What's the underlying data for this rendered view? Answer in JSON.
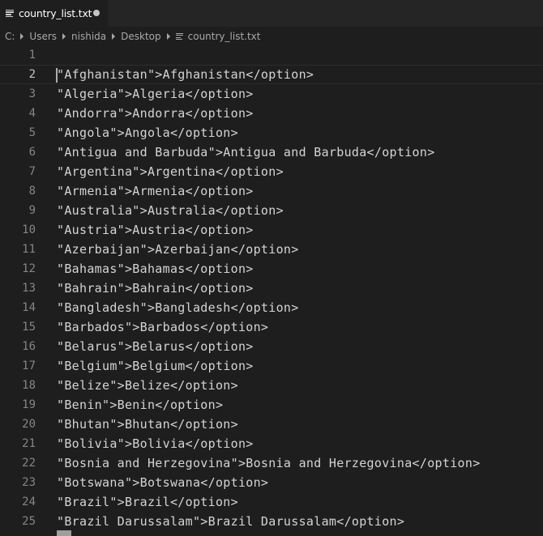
{
  "tab": {
    "filename": "country_list.txt",
    "icon": "lines-file-icon",
    "dirty": true
  },
  "breadcrumb": {
    "parts": [
      "C:",
      "Users",
      "nishida",
      "Desktop"
    ],
    "file": "country_list.txt"
  },
  "editor": {
    "current_line": 2,
    "lines": [
      {
        "num": "1",
        "text": ""
      },
      {
        "num": "2",
        "text": "\"Afghanistan\">Afghanistan</option>"
      },
      {
        "num": "3",
        "text": "\"Algeria\">Algeria</option>"
      },
      {
        "num": "4",
        "text": "\"Andorra\">Andorra</option>"
      },
      {
        "num": "5",
        "text": "\"Angola\">Angola</option>"
      },
      {
        "num": "6",
        "text": "\"Antigua and Barbuda\">Antigua and Barbuda</option>"
      },
      {
        "num": "7",
        "text": "\"Argentina\">Argentina</option>"
      },
      {
        "num": "8",
        "text": "\"Armenia\">Armenia</option>"
      },
      {
        "num": "9",
        "text": "\"Australia\">Australia</option>"
      },
      {
        "num": "10",
        "text": "\"Austria\">Austria</option>"
      },
      {
        "num": "11",
        "text": "\"Azerbaijan\">Azerbaijan</option>"
      },
      {
        "num": "12",
        "text": "\"Bahamas\">Bahamas</option>"
      },
      {
        "num": "13",
        "text": "\"Bahrain\">Bahrain</option>"
      },
      {
        "num": "14",
        "text": "\"Bangladesh\">Bangladesh</option>"
      },
      {
        "num": "15",
        "text": "\"Barbados\">Barbados</option>"
      },
      {
        "num": "16",
        "text": "\"Belarus\">Belarus</option>"
      },
      {
        "num": "17",
        "text": "\"Belgium\">Belgium</option>"
      },
      {
        "num": "18",
        "text": "\"Belize\">Belize</option>"
      },
      {
        "num": "19",
        "text": "\"Benin\">Benin</option>"
      },
      {
        "num": "20",
        "text": "\"Bhutan\">Bhutan</option>"
      },
      {
        "num": "21",
        "text": "\"Bolivia\">Bolivia</option>"
      },
      {
        "num": "22",
        "text": "\"Bosnia and Herzegovina\">Bosnia and Herzegovina</option>"
      },
      {
        "num": "23",
        "text": "\"Botswana\">Botswana</option>"
      },
      {
        "num": "24",
        "text": "\"Brazil\">Brazil</option>"
      },
      {
        "num": "25",
        "text": "\"Brazil Darussalam\">Brazil Darussalam</option>"
      }
    ]
  }
}
